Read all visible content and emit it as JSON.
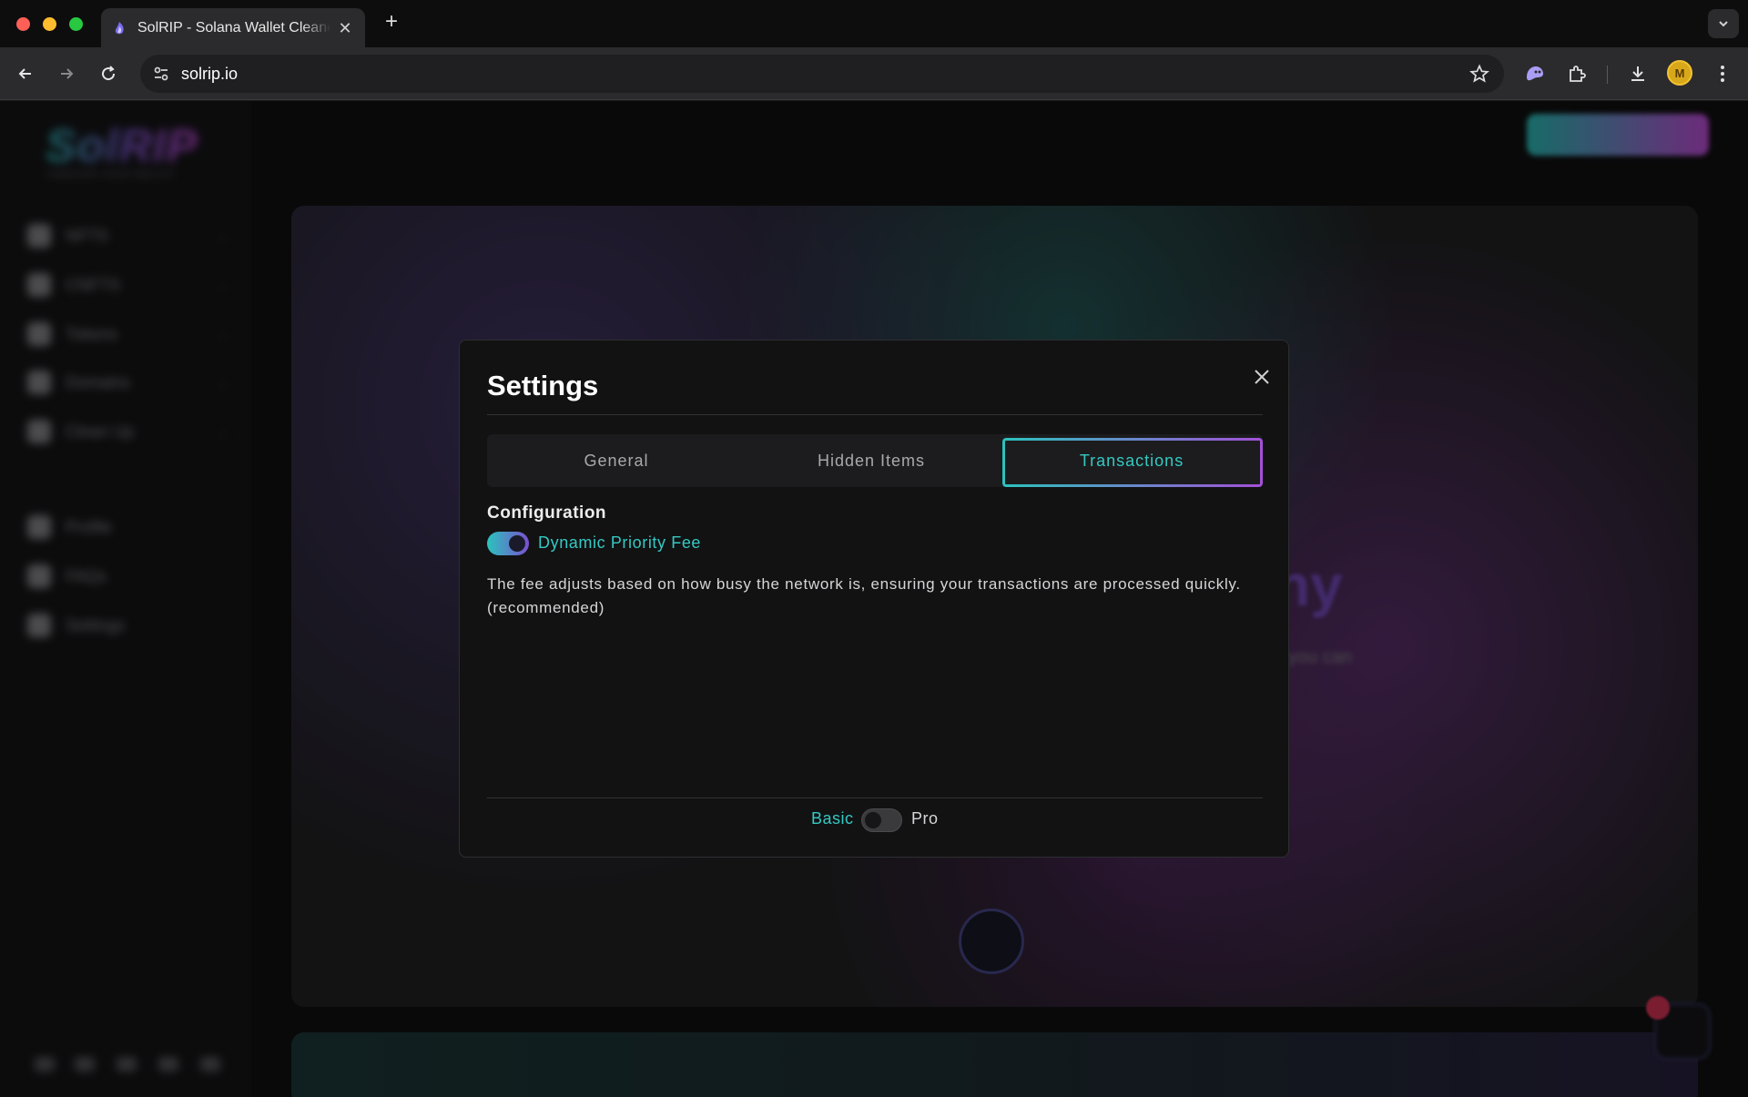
{
  "browser": {
    "tab_title": "SolRIP - Solana Wallet Cleaner",
    "url": "solrip.io",
    "profile_initial": "M"
  },
  "page": {
    "logo": "SolRIP",
    "logo_sub": "FOREVER YOUR WALLET",
    "sidebar": {
      "items": [
        {
          "label": "NFTS",
          "icon": "nft-icon"
        },
        {
          "label": "CNFTS",
          "icon": "cnft-icon"
        },
        {
          "label": "Tokens",
          "icon": "token-icon"
        },
        {
          "label": "Domains",
          "icon": "domain-icon"
        },
        {
          "label": "Clean Up",
          "icon": "cleanup-icon"
        },
        {
          "label": "Profile",
          "icon": "profile-icon"
        },
        {
          "label": "FAQs",
          "icon": "faq-icon"
        },
        {
          "label": "Settings",
          "icon": "settings-icon"
        }
      ]
    },
    "hero_partial_text": "ny",
    "hero_partial_sub": "you can",
    "accent_gradient": [
      "#2bc3bd",
      "#c64fe0"
    ]
  },
  "modal": {
    "title": "Settings",
    "tabs": [
      {
        "label": "General",
        "active": false
      },
      {
        "label": "Hidden Items",
        "active": false
      },
      {
        "label": "Transactions",
        "active": true
      }
    ],
    "section_title": "Configuration",
    "dynamic_priority_fee": {
      "label": "Dynamic Priority Fee",
      "enabled": true
    },
    "description": "The fee adjusts based on how busy the network is, ensuring your transactions are processed quickly. (recommended)",
    "mode": {
      "basic_label": "Basic",
      "pro_label": "Pro",
      "selected": "Basic"
    }
  }
}
